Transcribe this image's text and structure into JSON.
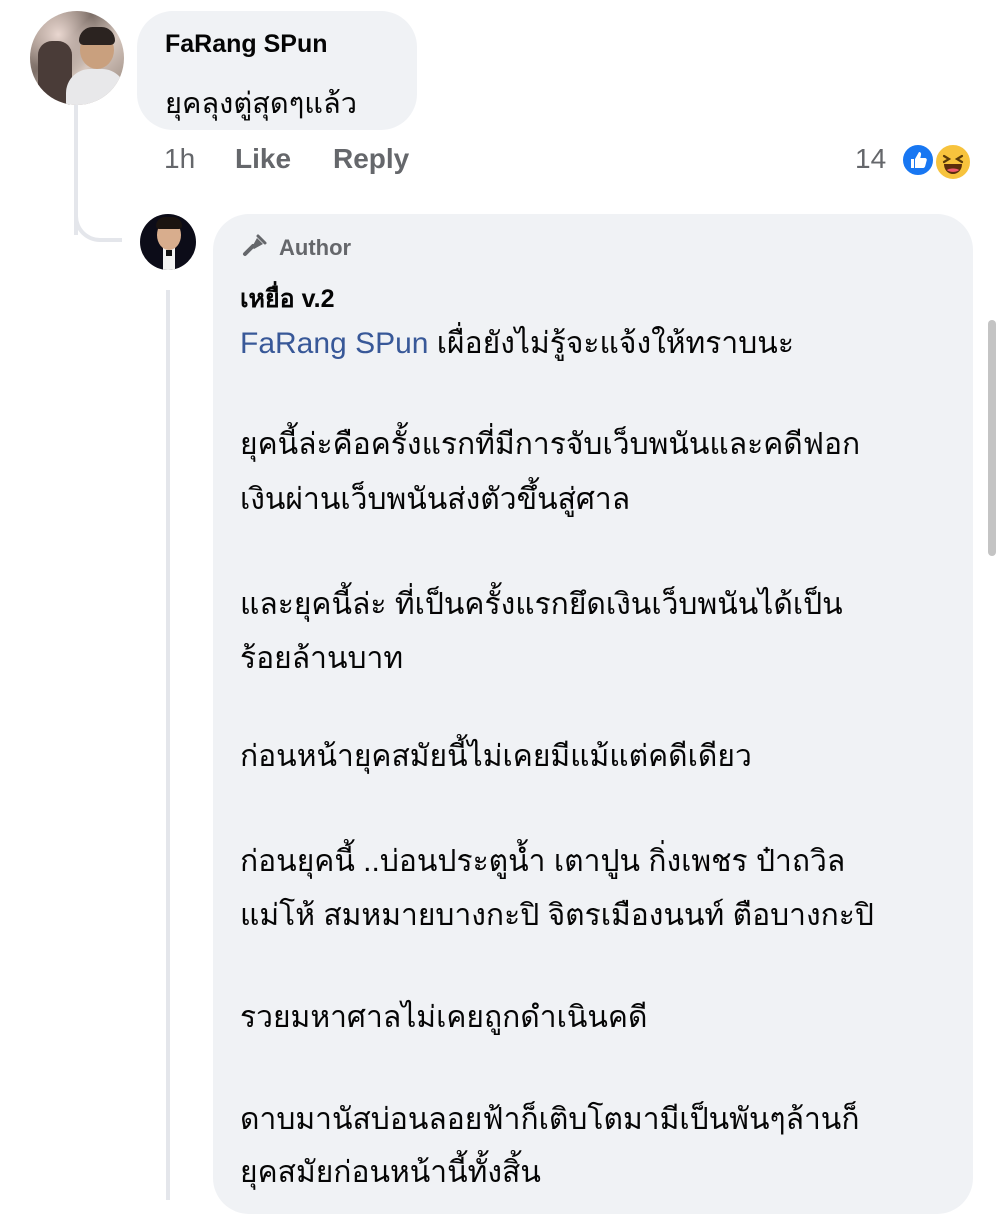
{
  "comment": {
    "author": "FaRang SPun",
    "text": "ยุคลุงตู่สุดๆแล้ว",
    "time": "1h",
    "like_label": "Like",
    "reply_label": "Reply",
    "reaction_count": "14",
    "reactions": [
      "like-icon",
      "haha-icon"
    ]
  },
  "reply": {
    "badge_icon": "megaphone-icon",
    "badge_label": "Author",
    "author": "เหยื่อ v.2",
    "mention": "FaRang SPun",
    "paragraphs": [
      "เผื่อยังไม่รู้จะแจ้งให้ทราบนะ",
      "ยุคนี้ล่ะคือครั้งแรกที่มีการจับเว็บพนันและคดีฟอก",
      "เงินผ่านเว็บพนันส่งตัวขึ้นสู่ศาล",
      "และยุคนี้ล่ะ ที่เป็นครั้งแรกยึดเงินเว็บพนันได้เป็น",
      "ร้อยล้านบาท",
      "ก่อนหน้ายุคสมัยนี้ไม่เคยมีแม้แต่คดีเดียว",
      "ก่อนยุคนี้ ..บ่อนประตูน้ำ เตาปูน กิ่งเพชร ป๋าถวิล",
      "แม่โห้ สมหมายบางกะปิ จิตรเมืองนนท์ ตือบางกะปิ",
      "รวยมหาศาลไม่เคยถูกดำเนินคดี",
      "ดาบมานัสบ่อนลอยฟ้าก็เติบโตมามีเป็นพันๆล้านก็",
      "ยุคสมัยก่อนหน้านี้ทั้งสิ้น"
    ]
  },
  "colors": {
    "bubble": "#f0f2f5",
    "mention": "#385898",
    "meta": "#65676b",
    "like": "#1877f2",
    "haha": "#f7c33d"
  }
}
